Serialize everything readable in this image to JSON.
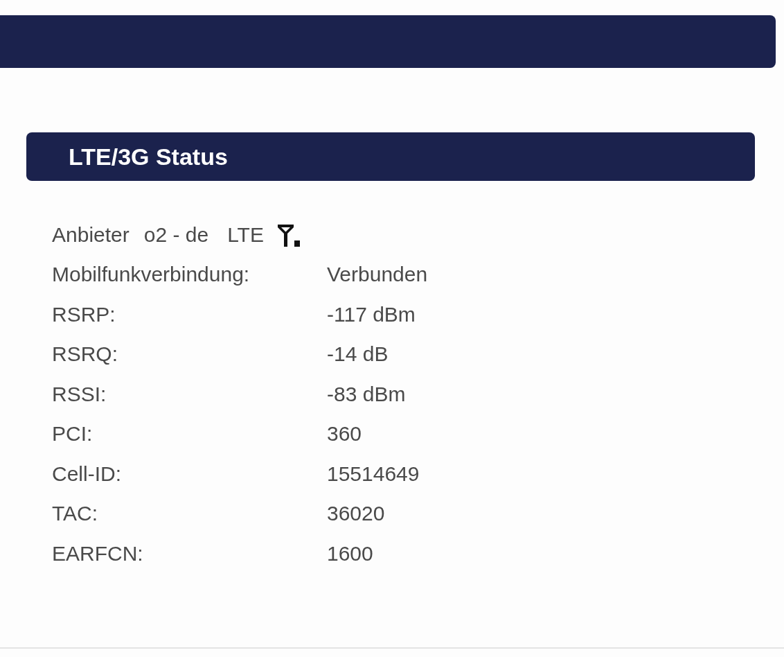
{
  "section": {
    "title": "LTE/3G Status"
  },
  "provider": {
    "label": "Anbieter",
    "name": "o2 - de",
    "network": "LTE"
  },
  "rows": [
    {
      "label": "Mobilfunkverbindung:",
      "value": "Verbunden"
    },
    {
      "label": "RSRP:",
      "value": "-117 dBm"
    },
    {
      "label": "RSRQ:",
      "value": "-14 dB"
    },
    {
      "label": "RSSI:",
      "value": "-83 dBm"
    },
    {
      "label": "PCI:",
      "value": "360"
    },
    {
      "label": "Cell-ID:",
      "value": "15514649"
    },
    {
      "label": "TAC:",
      "value": "36020"
    },
    {
      "label": "EARFCN:",
      "value": "1600"
    }
  ]
}
